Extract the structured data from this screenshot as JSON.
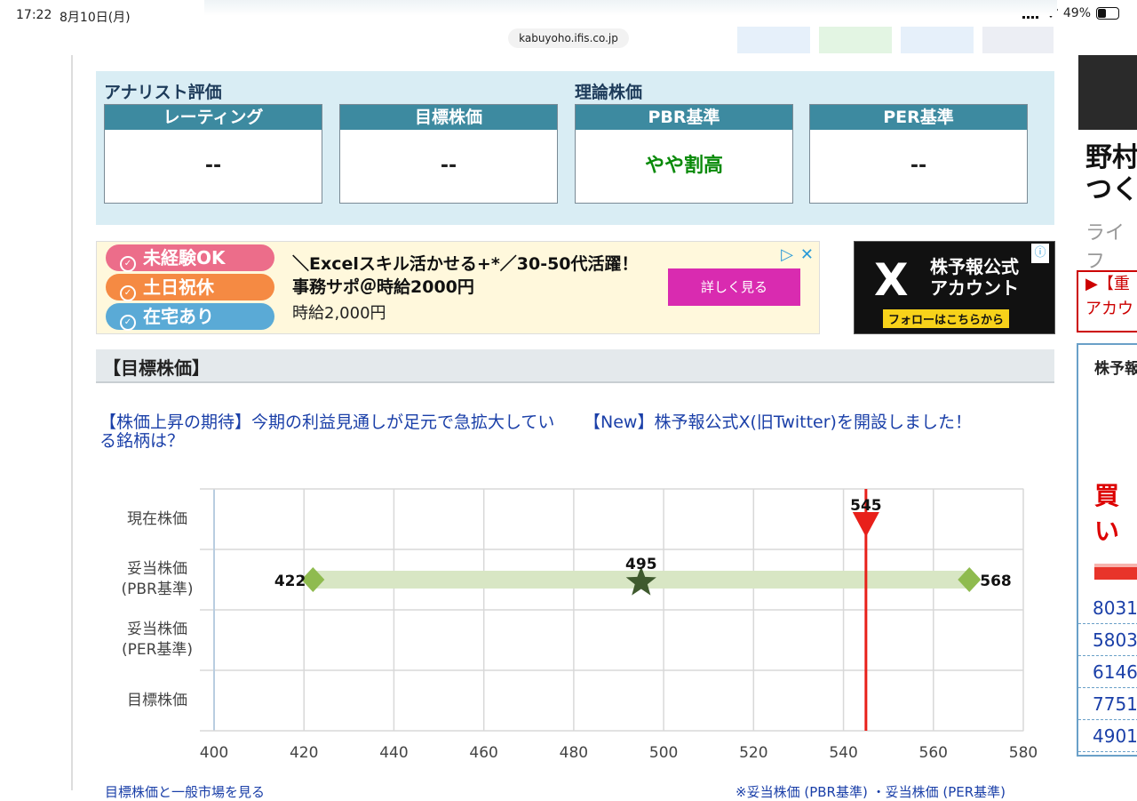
{
  "status": {
    "time": "17:22",
    "date": "8月10日(月)",
    "battery": "49%",
    "url": "kabuyoho.ifis.co.jp"
  },
  "analyst": {
    "section_title": "アナリスト評価",
    "cards": [
      {
        "label": "レーティング",
        "value": "--"
      },
      {
        "label": "目標株価",
        "value": "--"
      }
    ]
  },
  "theory": {
    "section_title": "理論株価",
    "cards": [
      {
        "label": "PBR基準",
        "value": "やや割高"
      },
      {
        "label": "PER基準",
        "value": "--"
      }
    ]
  },
  "ad": {
    "badges": [
      "未経験OK",
      "土日祝休",
      "在宅あり"
    ],
    "badge_colors": [
      "#ec6d8a",
      "#f58a43",
      "#5aaad6"
    ],
    "headline": "＼Excelスキル活かせる+*／30-50代活躍！事務サポ＠時給2000円",
    "sub": "時給2,000円",
    "button": "詳しく見る"
  },
  "x_ad": {
    "logo": "X",
    "text_line1": "株予報公式",
    "text_line2": "アカウント",
    "follow": "フォローはこちらから"
  },
  "target_section": {
    "title": "【目標株価】"
  },
  "news": [
    {
      "text": "【株価上昇の期待】今期の利益見通しが足元で急拡大している銘柄は？"
    },
    {
      "text": "【New】株予報公式X(旧Twitter)を開設しました！"
    }
  ],
  "chart_data": {
    "type": "range",
    "rows": [
      "現在株価",
      "妥当株価\n(PBR基準)",
      "妥当株価\n(PER基準)",
      "目標株価"
    ],
    "xlim": [
      400,
      580
    ],
    "x_ticks": [
      400,
      420,
      440,
      460,
      480,
      500,
      520,
      540,
      560,
      580
    ],
    "current_price": 545,
    "pbr_range": {
      "low": 422,
      "mid": 495,
      "high": 568
    },
    "colors": {
      "range": "#d8e6c4",
      "diamond": "#8fbb4f",
      "star": "#3f5a2e",
      "current": "#e8201a",
      "grid": "#d8d8d8"
    }
  },
  "right": {
    "title_line1": "野村",
    "title_line2": "つく",
    "sub": "ライフ",
    "alert_line1": "▶【重",
    "alert_line2": "アカウ",
    "box_title": "株予報",
    "buy": "買い",
    "codes": [
      "8031",
      "5803",
      "6146",
      "7751",
      "4901"
    ]
  },
  "bottom": {
    "left": "目標株価と一般市場を見る",
    "right": "※妥当株価 (PBR基準) ・妥当株価 (PER基準)"
  }
}
